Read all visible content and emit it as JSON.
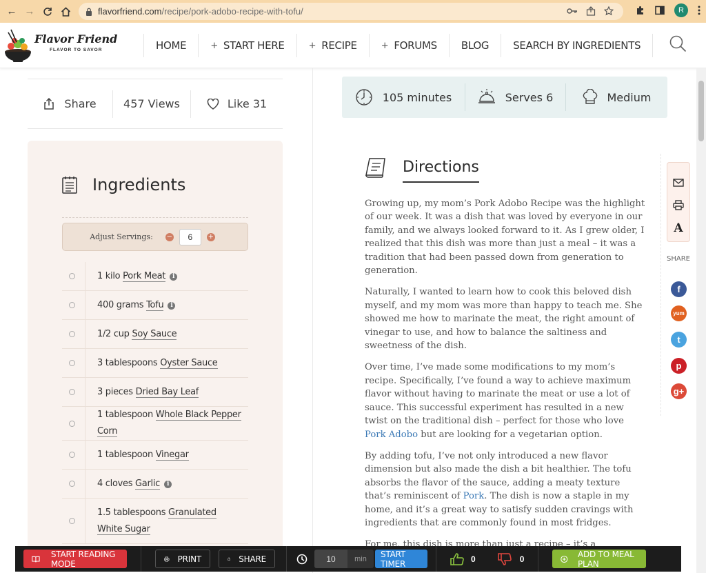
{
  "browser": {
    "url_host": "flavorfriend.com",
    "url_path": "/recipe/pork-adobo-recipe-with-tofu/",
    "profile_initial": "R"
  },
  "site": {
    "logo_name": "Flavor Friend",
    "logo_tagline": "FLAVOR TO SAVOR",
    "nav": [
      {
        "label": "HOME",
        "plus": false
      },
      {
        "label": "START HERE",
        "plus": true
      },
      {
        "label": "RECIPE",
        "plus": true
      },
      {
        "label": "FORUMS",
        "plus": true
      },
      {
        "label": "BLOG",
        "plus": false
      },
      {
        "label": "SEARCH BY INGREDIENTS",
        "plus": false
      }
    ]
  },
  "share_bar": {
    "share_label": "Share",
    "views": "457 Views",
    "like": "Like 31"
  },
  "meta": {
    "time": "105 minutes",
    "serves": "Serves 6",
    "difficulty": "Medium"
  },
  "ingredients": {
    "title": "Ingredients",
    "adjust_label": "Adjust Servings:",
    "minus": "−",
    "plus": "+",
    "servings": "6",
    "items": [
      {
        "qty": "1 kilo",
        "name": "Pork Meat",
        "info": true
      },
      {
        "qty": "400 grams",
        "name": "Tofu",
        "info": true
      },
      {
        "qty": "1/2 cup",
        "name": "Soy Sauce",
        "info": false
      },
      {
        "qty": "3 tablespoons",
        "name": "Oyster Sauce",
        "info": false
      },
      {
        "qty": "3 pieces",
        "name": "Dried Bay Leaf",
        "info": false
      },
      {
        "qty": "1 tablespoon",
        "name": "Whole Black Pepper Corn",
        "info": false
      },
      {
        "qty": "1 tablespoon",
        "name": "Vinegar",
        "info": false
      },
      {
        "qty": "4 cloves",
        "name": "Garlic",
        "info": true
      },
      {
        "qty": "1.5 tablespoons",
        "name": "Granulated White Sugar",
        "info": false
      }
    ]
  },
  "directions": {
    "title": "Directions",
    "paragraphs": [
      [
        {
          "t": "Growing up, my mom’s Pork Adobo Recipe was the highlight of our week. It was a dish that was loved by everyone in our family, and we always looked forward to it. As I grew older, I realized that this dish was more than just a meal – it was a tradition that had been passed down from generation to generation."
        }
      ],
      [
        {
          "t": "Naturally, I wanted to learn how to cook this beloved dish myself, and my mom was more than happy to teach me. She showed me how to marinate the meat, the right amount of vinegar to use, and how to balance the saltiness and sweetness of the dish."
        }
      ],
      [
        {
          "t": "Over time, I’ve made some modifications to my mom’s recipe. Specifically, I’ve found a way to achieve maximum flavor without having to marinate the meat or use a lot of sauce. This successful experiment has resulted in a new twist on the traditional dish – perfect for those who love "
        },
        {
          "t": "Pork Adobo",
          "link": true
        },
        {
          "t": " but are looking for a vegetarian option."
        }
      ],
      [
        {
          "t": "By adding tofu, I’ve not only introduced a new flavor dimension but also made the dish a bit healthier. The tofu absorbs the flavor of the sauce, adding a meaty texture that’s reminiscent of "
        },
        {
          "t": "Pork",
          "link": true
        },
        {
          "t": ". The dish is now a staple in my home, and it’s a great way to satisfy sudden cravings with ingredients that are commonly found in most fridges."
        }
      ],
      [
        {
          "t": "For me, this dish is more than just a recipe – it’s a connection to"
        }
      ]
    ]
  },
  "rail": {
    "share_label": "SHARE",
    "font_glyph": "A",
    "socials": [
      {
        "name": "facebook",
        "glyph": "f",
        "color": "#3b5998"
      },
      {
        "name": "yummly",
        "glyph": "yum",
        "color": "#e16120"
      },
      {
        "name": "twitter",
        "glyph": "t",
        "color": "#4aa3df"
      },
      {
        "name": "pinterest",
        "glyph": "p",
        "color": "#cb2027"
      },
      {
        "name": "google-plus",
        "glyph": "g+",
        "color": "#dc4a38"
      }
    ]
  },
  "toolbar": {
    "reading_mode": "START READING MODE",
    "print": "PRINT",
    "share": "SHARE",
    "timer_value": "10",
    "timer_unit": "min",
    "start_timer": "START TIMER",
    "likes": "0",
    "dislikes": "0",
    "meal_plan": "ADD TO MEAL PLAN"
  },
  "colors": {
    "chrome_bg": "#f7d8a9",
    "ingredients_bg": "#f9f2ee",
    "meta_bg": "#e8f1f1",
    "link": "#3a78b5",
    "reading_mode": "#d9343b",
    "start_timer": "#2f86d8",
    "meal_plan": "#88b935"
  }
}
